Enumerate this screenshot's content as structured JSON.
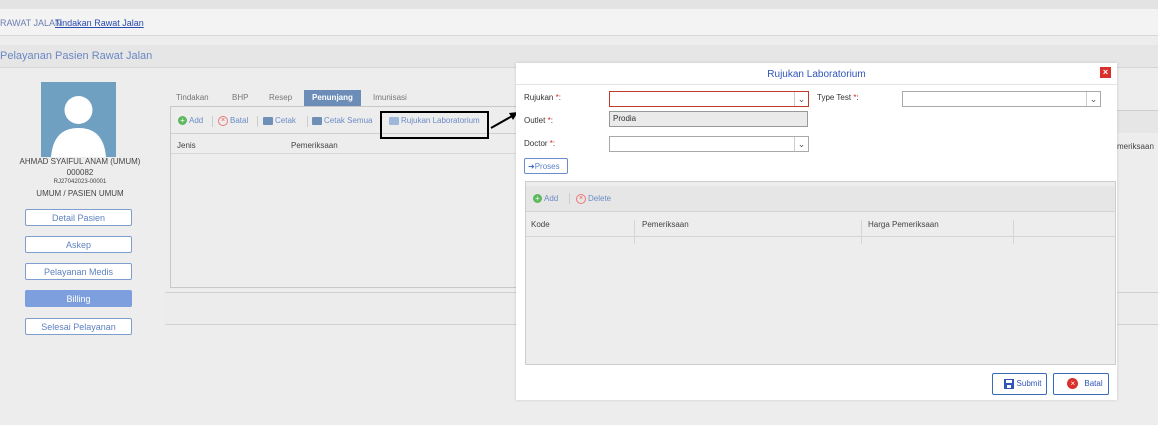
{
  "breadcrumb": {
    "root": "RAWAT JALAN",
    "current": "Tindakan Rawat Jalan"
  },
  "section": {
    "title": "Pelayanan Pasien Rawat Jalan"
  },
  "patient": {
    "name": "AHMAD SYAIFUL ANAM (UMUM)",
    "id": "000082",
    "reg": "RJ27042023-00001",
    "type": "UMUM / PASIEN UMUM"
  },
  "sidebar": {
    "buttons": [
      {
        "label": "Detail Pasien"
      },
      {
        "label": "Askep"
      },
      {
        "label": "Pelayanan Medis"
      },
      {
        "label": "Billing"
      },
      {
        "label": "Selesai Pelayanan"
      }
    ]
  },
  "tabs": [
    {
      "label": "Tindakan"
    },
    {
      "label": "BHP"
    },
    {
      "label": "Resep"
    },
    {
      "label": "Penunjang"
    },
    {
      "label": "Imunisasi"
    }
  ],
  "toolbar": {
    "add": "Add",
    "batal": "Batal",
    "cetak": "Cetak",
    "cetak_semua": "Cetak Semua",
    "rujukan_lab": "Rujukan Laboratorium"
  },
  "grid": {
    "col_jenis": "Jenis",
    "col_pemeriksaan": "Pemeriksaan",
    "col_pemeriksaan_right": "meriksaan"
  },
  "modal": {
    "title": "Rujukan Laboratorium",
    "close": "×",
    "rujukan_label": "Rujukan",
    "outlet_label": "Outlet",
    "doctor_label": "Doctor",
    "type_test_label": "Type Test",
    "req": "*",
    "colon": ":",
    "arrow": "⌄",
    "dropdown_option": "Prodia",
    "proses": "Proses",
    "inner_add": "Add",
    "inner_delete": "Delete",
    "col_kode": "Kode",
    "col_pemeriksaan": "Pemeriksaan",
    "col_harga": "Harga Pemeriksaan",
    "submit": "Submit",
    "batal": "Batal"
  }
}
